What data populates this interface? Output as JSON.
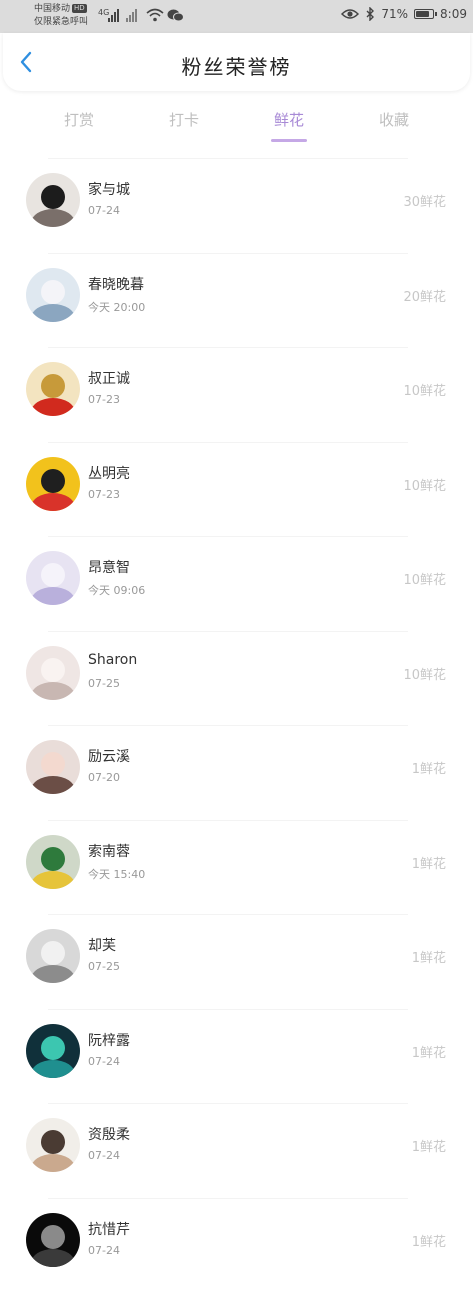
{
  "status_bar": {
    "carrier_line1": "中国移动",
    "carrier_hd": "HD",
    "carrier_line2": "仅限紧急呼叫",
    "network": "4G",
    "battery": "71%",
    "time": "8:09",
    "icons": [
      "signal-icon",
      "wifi-icon",
      "wechat-icon",
      "eye-icon",
      "bluetooth-icon",
      "battery-icon"
    ]
  },
  "header": {
    "title": "粉丝荣誉榜",
    "back_icon": "chevron-left-icon",
    "accent_color": "#2f8fe0"
  },
  "tabs": [
    {
      "label": "打赏",
      "active": false
    },
    {
      "label": "打卡",
      "active": false
    },
    {
      "label": "鲜花",
      "active": true
    },
    {
      "label": "收藏",
      "active": false
    }
  ],
  "active_tab_color": "#a88ad6",
  "fans": [
    {
      "name": "家与城",
      "time": "07-24",
      "flowers": "30鲜花"
    },
    {
      "name": "春晓晚暮",
      "time": "今天 20:00",
      "flowers": "20鲜花"
    },
    {
      "name": "叔正诚",
      "time": "07-23",
      "flowers": "10鲜花"
    },
    {
      "name": "丛明亮",
      "time": "07-23",
      "flowers": "10鲜花"
    },
    {
      "name": "昂意智",
      "time": "今天 09:06",
      "flowers": "10鲜花"
    },
    {
      "name": "Sharon",
      "time": "07-25",
      "flowers": "10鲜花"
    },
    {
      "name": "励云溪",
      "time": "07-20",
      "flowers": "1鲜花"
    },
    {
      "name": "索南蓉",
      "time": "今天 15:40",
      "flowers": "1鲜花"
    },
    {
      "name": "却芙",
      "time": "07-25",
      "flowers": "1鲜花"
    },
    {
      "name": "阮梓露",
      "time": "07-24",
      "flowers": "1鲜花"
    },
    {
      "name": "资殷柔",
      "time": "07-24",
      "flowers": "1鲜花"
    },
    {
      "name": "抗惜芹",
      "time": "07-24",
      "flowers": "1鲜花"
    }
  ]
}
